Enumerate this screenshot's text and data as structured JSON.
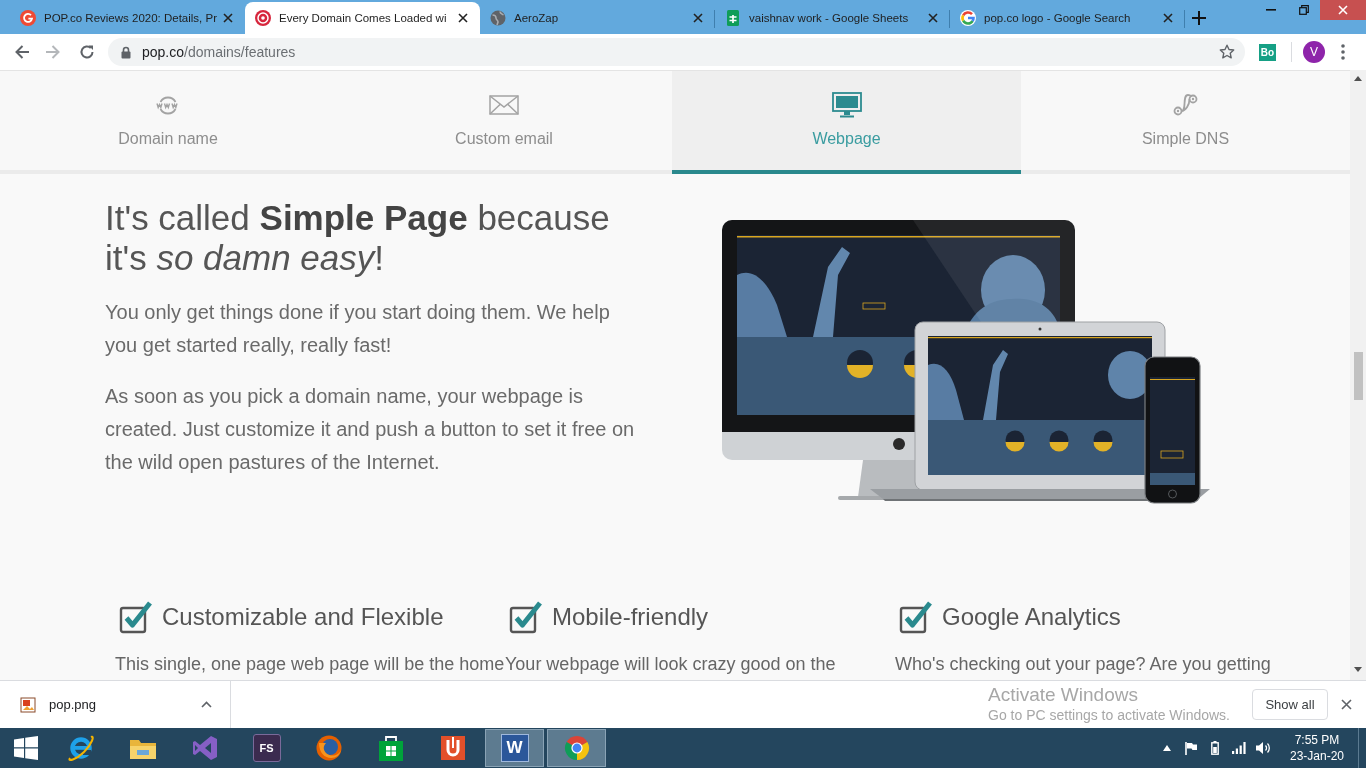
{
  "browser": {
    "tabs": [
      {
        "title": "POP.co Reviews 2020: Details, Pr",
        "selected": false
      },
      {
        "title": "Every Domain Comes Loaded wi",
        "selected": true
      },
      {
        "title": "AeroZap",
        "selected": false
      },
      {
        "title": "vaishnav work - Google Sheets",
        "selected": false
      },
      {
        "title": "pop.co logo - Google Search",
        "selected": false
      }
    ],
    "address": {
      "host": "pop.co",
      "path": "/domains/features"
    },
    "extension": "Bo",
    "profile": "V"
  },
  "feature_tabs": [
    {
      "label": "Domain name",
      "selected": false
    },
    {
      "label": "Custom email",
      "selected": false
    },
    {
      "label": "Webpage",
      "selected": true
    },
    {
      "label": "Simple DNS",
      "selected": false
    }
  ],
  "hero": {
    "heading": "It's called **Simple Page** because it's *so damn easy*!",
    "paragraphs": [
      "You only get things done if you start doing them. We help you get started really, really fast!",
      "As soon as you pick a domain name, your webpage is created. Just customize it and push a button to set it free on the wild open pastures of the Internet."
    ]
  },
  "features": [
    {
      "title": "Customizable and Flexible",
      "text": "This single, one page web page will be the home"
    },
    {
      "title": "Mobile-friendly",
      "text": "Your webpage will look crazy good on the"
    },
    {
      "title": "Google Analytics",
      "text": "Who's checking out your page? Are you getting"
    }
  ],
  "activation_notice": {
    "title": "Activate Windows",
    "detail": "Go to PC settings to activate Windows."
  },
  "download_bar": {
    "file": "pop.png",
    "button": "Show all"
  },
  "taskbar": {
    "apps": [
      {
        "kind": "ie",
        "open": false
      },
      {
        "kind": "folder",
        "open": false
      },
      {
        "kind": "studio",
        "open": false
      },
      {
        "kind": "tile",
        "label": "FS",
        "open": false
      },
      {
        "kind": "firefox",
        "open": false
      },
      {
        "kind": "store",
        "open": false
      },
      {
        "kind": "reader",
        "open": false
      },
      {
        "kind": "word",
        "label": "W",
        "open": true
      },
      {
        "kind": "chrome",
        "open": true
      }
    ],
    "time": "7:55 PM",
    "date": "23-Jan-20"
  }
}
